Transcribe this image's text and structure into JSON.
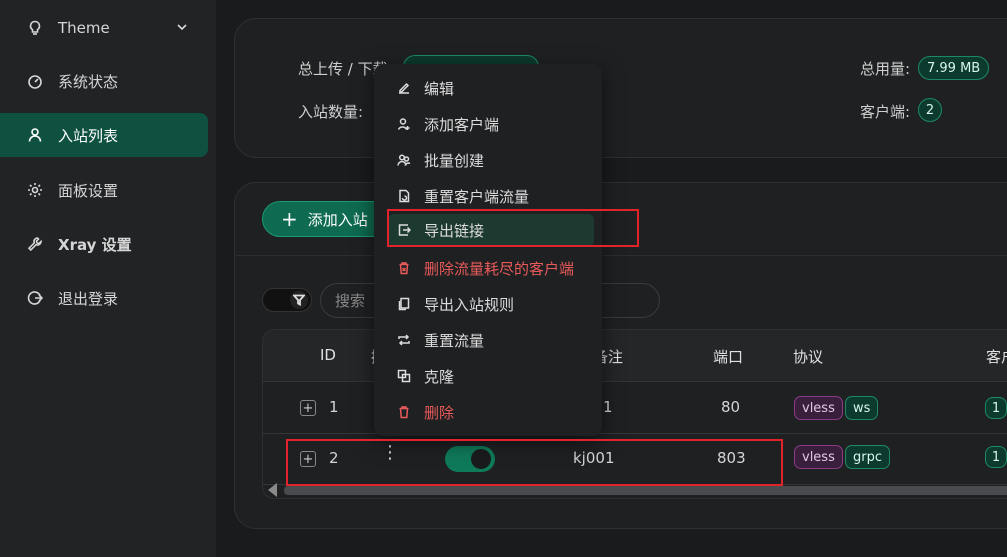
{
  "sidebar": {
    "items": [
      {
        "label": "Theme",
        "icon": "bulb-icon"
      },
      {
        "label": "系统状态",
        "icon": "dashboard-icon"
      },
      {
        "label": "入站列表",
        "icon": "user-icon",
        "active": true
      },
      {
        "label": "面板设置",
        "icon": "gear-icon"
      },
      {
        "label": "Xray 设置",
        "icon": "wrench-icon"
      },
      {
        "label": "退出登录",
        "icon": "logout-icon"
      }
    ]
  },
  "stats": {
    "traffic_label": "总上传 / 下载:",
    "inbounds_label": "入站数量:",
    "total_label": "总用量:",
    "total_value": "7.99 MB",
    "clients_label": "客户端:",
    "clients_value": "2"
  },
  "toolbar": {
    "add_label": "添加入站",
    "search_placeholder": "搜索"
  },
  "table": {
    "headers": {
      "id": "ID",
      "ops": "操",
      "remark": "备注",
      "port": "端口",
      "protocol": "协议",
      "clients": "客户"
    },
    "rows": [
      {
        "id": "1",
        "remark": "1",
        "port": "80",
        "protocol": "vless",
        "transport": "ws",
        "clients": "1"
      },
      {
        "id": "2",
        "remark": "kj001",
        "port": "803",
        "protocol": "vless",
        "transport": "grpc",
        "clients": "1"
      }
    ]
  },
  "menu": {
    "items": [
      {
        "label": "编辑",
        "icon": "edit-icon"
      },
      {
        "label": "添加客户端",
        "icon": "user-add-icon"
      },
      {
        "label": "批量创建",
        "icon": "users-icon"
      },
      {
        "label": "重置客户端流量",
        "icon": "file-reset-icon"
      },
      {
        "label": "导出链接",
        "icon": "export-icon"
      },
      {
        "label": "删除流量耗尽的客户端",
        "icon": "trash-clear-icon"
      },
      {
        "label": "导出入站规则",
        "icon": "copy-icon"
      },
      {
        "label": "重置流量",
        "icon": "retweet-icon"
      },
      {
        "label": "克隆",
        "icon": "clone-icon"
      },
      {
        "label": "删除",
        "icon": "delete-icon"
      }
    ]
  },
  "colors": {
    "accent": "#0f5140",
    "danger": "#e85a5a",
    "annotation": "#e3232b"
  }
}
